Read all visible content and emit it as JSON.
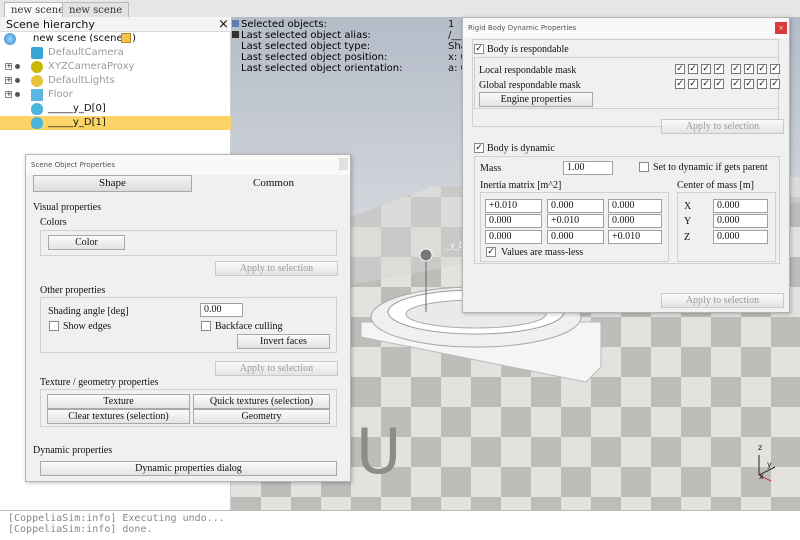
{
  "tabs": [
    "new scene",
    "new scene"
  ],
  "hierarchy": {
    "title": "Scene hierarchy",
    "close": "×",
    "items": [
      {
        "label": "new scene (scene 1)",
        "icon": "globe-icon"
      },
      {
        "label": "DefaultCamera",
        "icon": "camera-icon"
      },
      {
        "label": "XYZCameraProxy",
        "icon": "dummy-icon"
      },
      {
        "label": "DefaultLights",
        "icon": "light-icon"
      },
      {
        "label": "Floor",
        "icon": "cube-icon"
      },
      {
        "label": "_____y_D[0]",
        "icon": "shape-icon"
      },
      {
        "label": "_____y_D[1]",
        "icon": "shape-icon"
      }
    ]
  },
  "viewport": {
    "info_labels": [
      "Selected objects:",
      "Last selected object alias:",
      "Last selected object type:",
      "Last selected object position:",
      "Last selected object orientation:"
    ],
    "info_values": [
      "1",
      "/__",
      "Sha",
      "x: 0",
      "a: 0"
    ],
    "object_tag": "_y_D",
    "watermark": "U",
    "axes": {
      "z": "z",
      "y": "y",
      "x": "x"
    }
  },
  "scene_props": {
    "title": "Scene Object Properties",
    "tab_shape": "Shape",
    "tab_common": "Common",
    "visual_properties": "Visual properties",
    "colors": "Colors",
    "color_button": "Color",
    "apply_to_selection": "Apply to selection",
    "other_properties": "Other properties",
    "shading_angle_label": "Shading angle [deg]",
    "shading_angle_value": "0.00",
    "show_edges": "Show edges",
    "backface_culling": "Backface culling",
    "invert_faces": "Invert faces",
    "texture_geometry": "Texture / geometry properties",
    "texture": "Texture",
    "quick_textures": "Quick textures (selection)",
    "clear_textures": "Clear textures (selection)",
    "geometry": "Geometry",
    "dynamic_properties": "Dynamic properties",
    "dynamic_properties_dialog": "Dynamic properties dialog"
  },
  "rigid_body": {
    "title": "Rigid Body Dynamic Properties",
    "close": "×",
    "body_is_respondable": "Body is respondable",
    "local_mask": "Local respondable mask",
    "global_mask": "Global respondable mask",
    "check_mark": "✓",
    "engine_properties": "Engine properties",
    "apply_to_selection": "Apply to selection",
    "body_is_dynamic": "Body is dynamic",
    "mass_label": "Mass",
    "mass_value": "1.00",
    "set_dynamic_parent": "Set to dynamic if gets parent",
    "inertia_title": "Inertia matrix [m^2]",
    "inertia": [
      [
        "+0.010",
        "0.000",
        "0.000"
      ],
      [
        "0.000",
        "+0.010",
        "0.000"
      ],
      [
        "0.000",
        "0.000",
        "+0.010"
      ]
    ],
    "mass_less": "Values are mass-less",
    "com_title": "Center of mass [m]",
    "com_labels": [
      "X",
      "Y",
      "Z"
    ],
    "com_values": [
      "0.000",
      "0.000",
      "0.000"
    ]
  },
  "console": {
    "lines": [
      "[CoppeliaSim:info] Executing undo...",
      "[CoppeliaSim:info] done."
    ]
  }
}
